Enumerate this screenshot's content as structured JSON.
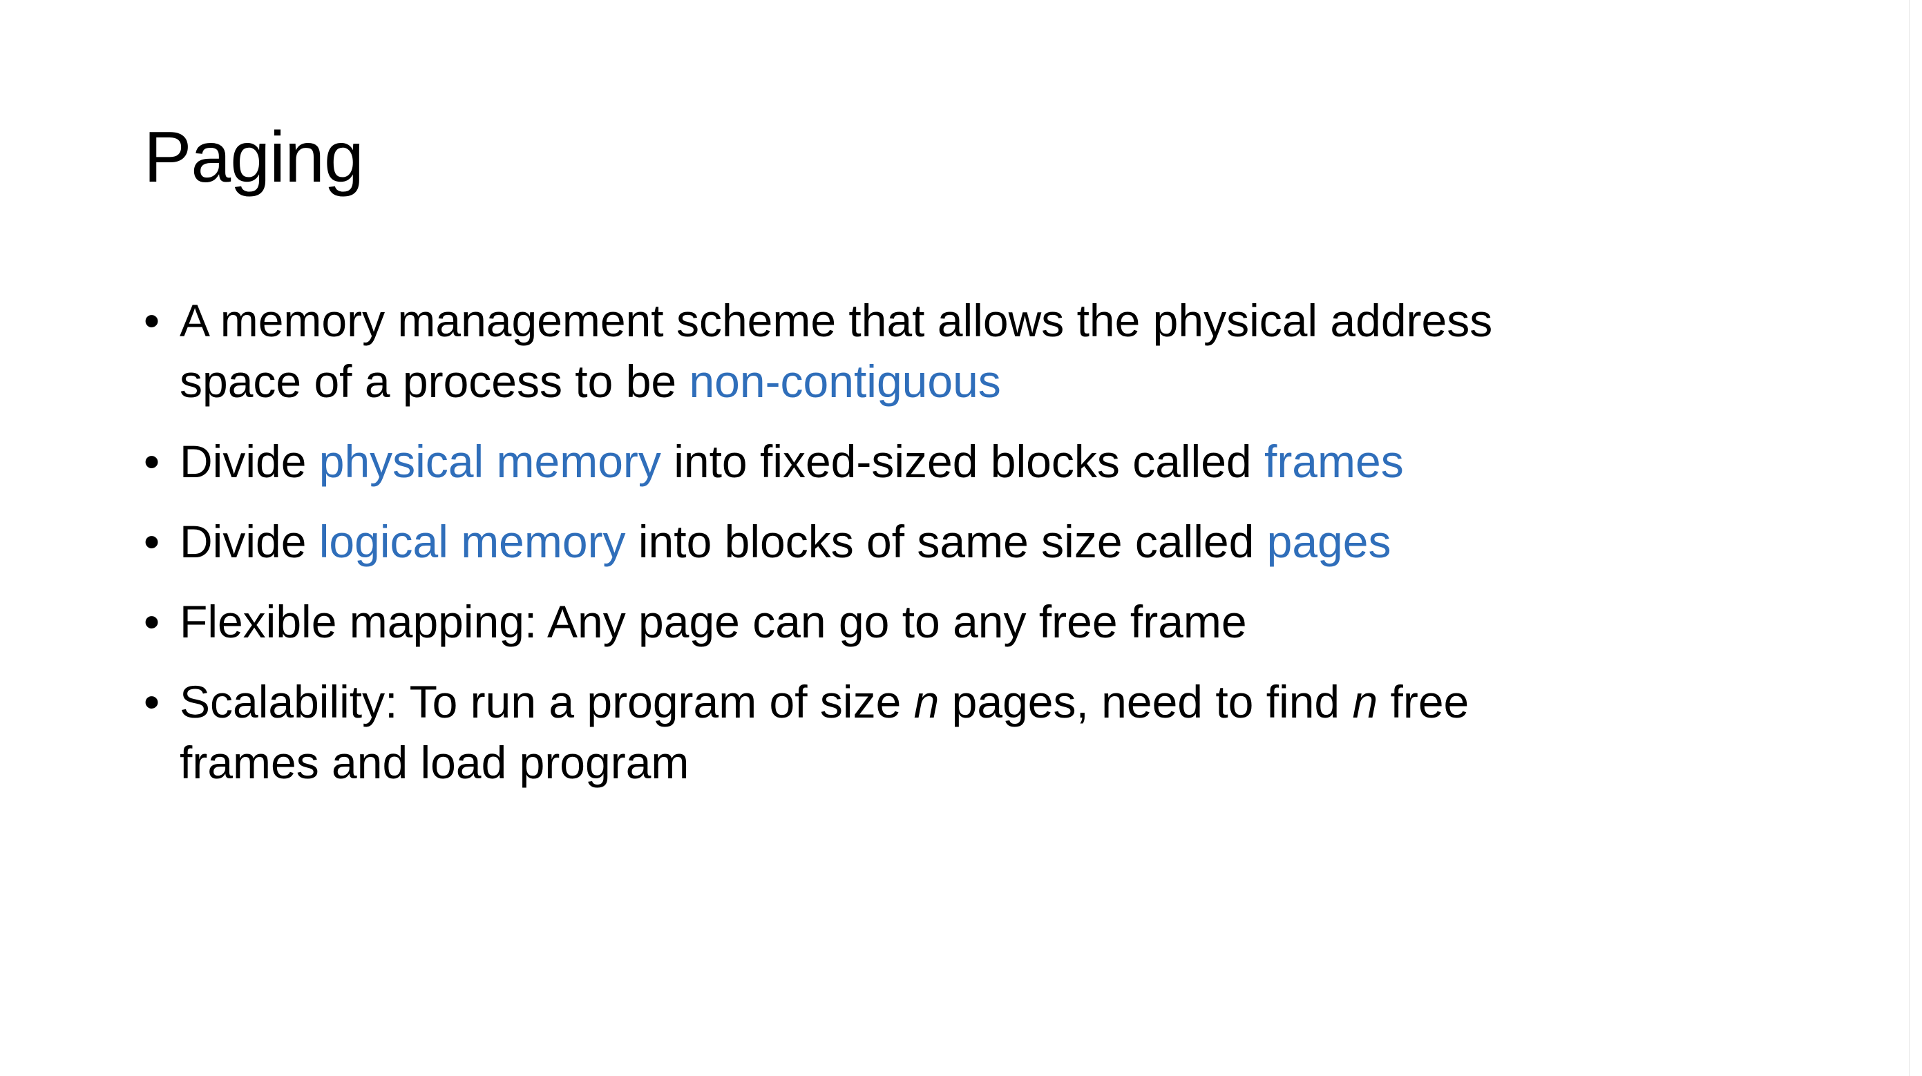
{
  "slide": {
    "title": "Paging",
    "accent_color": "#2F6EBA",
    "bullet_glyph": "•",
    "bullets": [
      {
        "line1_a": "A memory management scheme that allows the physical address",
        "line2_a": "space of a process to be ",
        "line2_hl": "non-contiguous"
      },
      {
        "a": "Divide ",
        "hl1": "physical memory",
        "b": " into fixed-sized blocks called ",
        "hl2": "frames"
      },
      {
        "a": "Divide ",
        "hl1": "logical memory",
        "b": " into blocks of same size called ",
        "hl2": "pages"
      },
      {
        "text": "Flexible mapping: Any page can go to any free frame"
      },
      {
        "line1_a": "Scalability: To run a program of size ",
        "line1_n1": "n",
        "line1_b": " pages, need to find ",
        "line1_n2": "n",
        "line1_c": " free",
        "line2": "frames and load program"
      }
    ]
  }
}
